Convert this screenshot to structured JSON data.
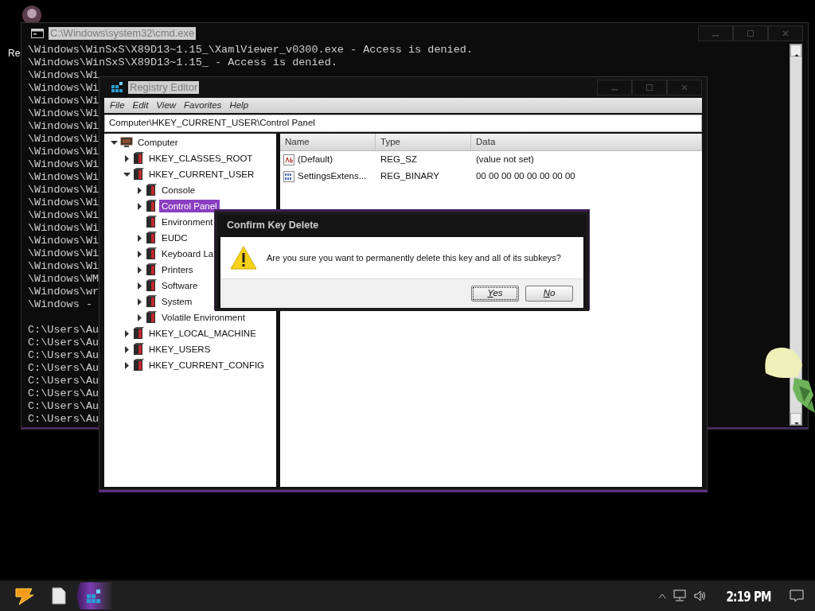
{
  "desktop": {
    "icon_label": "Re"
  },
  "cmd_window": {
    "title": "C:\\Windows\\system32\\cmd.exe",
    "lines": [
      "\\Windows\\WinSxS\\X89D13~1.15_\\XamlViewer_v0300.exe - Access is denied.",
      "\\Windows\\WinSxS\\X89D13~1.15_ - Access is denied.",
      "\\Windows\\Wi",
      "\\Windows\\Wi",
      "\\Windows\\Wi",
      "\\Windows\\Wi",
      "\\Windows\\Wi",
      "\\Windows\\Wi",
      "\\Windows\\Wi",
      "\\Windows\\Wi",
      "\\Windows\\Wi",
      "\\Windows\\Wi",
      "\\Windows\\Wi",
      "\\Windows\\Wi",
      "\\Windows\\Wi",
      "\\Windows\\Wi",
      "\\Windows\\Wi",
      "\\Windows\\Wi",
      "\\Windows\\WM",
      "\\Windows\\wr",
      "\\Windows - "
    ],
    "prompt_lines": [
      "C:\\Users\\Au",
      "C:\\Users\\Au",
      "C:\\Users\\Au",
      "C:\\Users\\Au",
      "C:\\Users\\Au",
      "C:\\Users\\Au",
      "C:\\Users\\Au",
      "C:\\Users\\Au"
    ]
  },
  "regedit": {
    "title": "Registry Editor",
    "menu": [
      "File",
      "Edit",
      "View",
      "Favorites",
      "Help"
    ],
    "address": "Computer\\HKEY_CURRENT_USER\\Control Panel",
    "tree": [
      {
        "label": "Computer",
        "kind": "computer",
        "expandable": true,
        "expanded": true,
        "selected": false,
        "children": [
          {
            "label": "HKEY_CLASSES_ROOT",
            "kind": "key",
            "expandable": true,
            "expanded": false,
            "selected": false
          },
          {
            "label": "HKEY_CURRENT_USER",
            "kind": "key",
            "expandable": true,
            "expanded": true,
            "selected": false,
            "children": [
              {
                "label": "Console",
                "kind": "key",
                "expandable": true,
                "expanded": false,
                "selected": false
              },
              {
                "label": "Control Panel",
                "kind": "key",
                "expandable": true,
                "expanded": false,
                "selected": true
              },
              {
                "label": "Environment",
                "kind": "key",
                "expandable": false,
                "expanded": false,
                "selected": false
              },
              {
                "label": "EUDC",
                "kind": "key",
                "expandable": true,
                "expanded": false,
                "selected": false
              },
              {
                "label": "Keyboard La",
                "kind": "key",
                "expandable": true,
                "expanded": false,
                "selected": false
              },
              {
                "label": "Printers",
                "kind": "key",
                "expandable": true,
                "expanded": false,
                "selected": false
              },
              {
                "label": "Software",
                "kind": "key",
                "expandable": true,
                "expanded": false,
                "selected": false
              },
              {
                "label": "System",
                "kind": "key",
                "expandable": true,
                "expanded": false,
                "selected": false
              },
              {
                "label": "Volatile Environment",
                "kind": "key",
                "expandable": true,
                "expanded": false,
                "selected": false
              }
            ]
          },
          {
            "label": "HKEY_LOCAL_MACHINE",
            "kind": "key",
            "expandable": true,
            "expanded": false,
            "selected": false
          },
          {
            "label": "HKEY_USERS",
            "kind": "key",
            "expandable": true,
            "expanded": false,
            "selected": false
          },
          {
            "label": "HKEY_CURRENT_CONFIG",
            "kind": "key",
            "expandable": true,
            "expanded": false,
            "selected": false
          }
        ]
      }
    ],
    "columns": [
      "Name",
      "Type",
      "Data"
    ],
    "values": [
      {
        "kind": "string",
        "name": "(Default)",
        "type": "REG_SZ",
        "data": "(value not set)"
      },
      {
        "kind": "binary",
        "name": "SettingsExtens...",
        "type": "REG_BINARY",
        "data": "00 00 00 00 00 00 00 00"
      }
    ]
  },
  "dialog": {
    "title": "Confirm Key Delete",
    "message": "Are you sure you want to permanently delete this key and all of its subkeys?",
    "buttons": [
      {
        "label": "Yes",
        "focused": true
      },
      {
        "label": "No",
        "focused": false
      }
    ]
  },
  "taskbar": {
    "items": [
      {
        "kind": "start",
        "active": false
      },
      {
        "kind": "file",
        "active": false
      },
      {
        "kind": "regedit",
        "active": true
      }
    ],
    "clock": "2:19 PM"
  }
}
